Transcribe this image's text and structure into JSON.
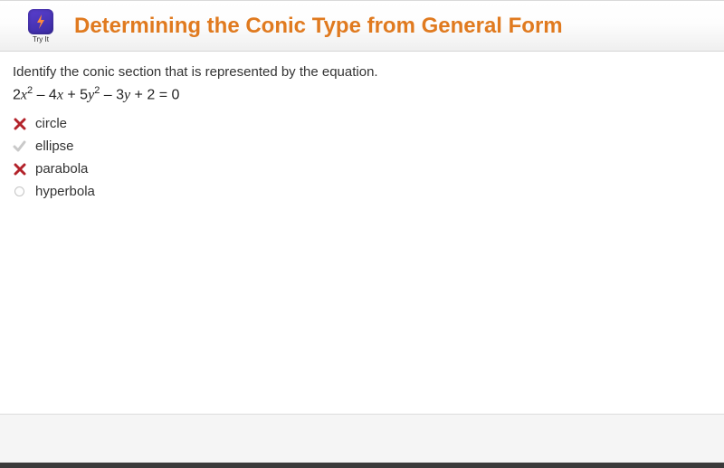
{
  "header": {
    "badge_label": "Try It",
    "title": "Determining the Conic Type from General Form"
  },
  "question": {
    "prompt": "Identify the conic section that is represented by the equation.",
    "equation_parts": {
      "p1": "2",
      "v1": "x",
      "e1": "2",
      "p2": " – 4",
      "v2": "x",
      "p3": " + 5",
      "v3": "y",
      "e2": "2",
      "p4": " – 3",
      "v4": "y",
      "p5": " + 2 = 0"
    }
  },
  "options": [
    {
      "label": "circle",
      "status": "wrong"
    },
    {
      "label": "ellipse",
      "status": "correct"
    },
    {
      "label": "parabola",
      "status": "wrong"
    },
    {
      "label": "hyperbola",
      "status": "unmarked"
    }
  ]
}
